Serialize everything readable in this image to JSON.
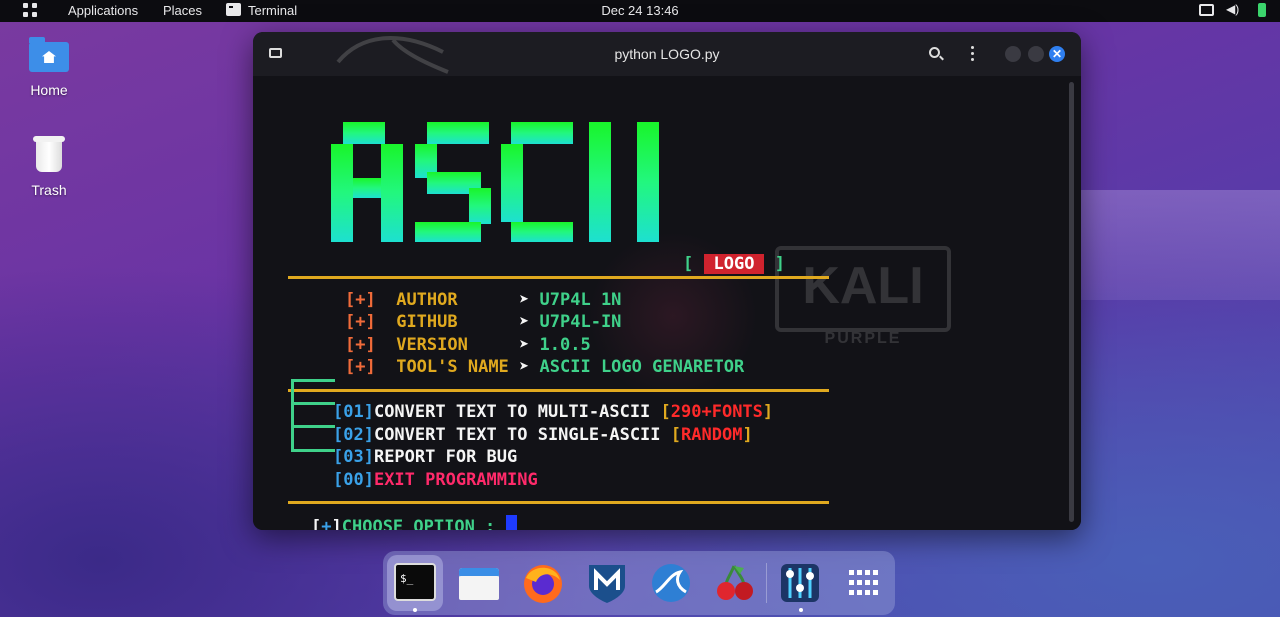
{
  "topbar": {
    "applications": "Applications",
    "places": "Places",
    "terminal": "Terminal",
    "clock": "Dec 24  13:46"
  },
  "desktop": {
    "home_label": "Home",
    "trash_label": "Trash"
  },
  "terminal_window": {
    "title": "python LOGO.py",
    "ascii_title_text": "ASCII",
    "logo_tag": {
      "open": "[",
      "label": "LOGO",
      "close": "]"
    },
    "info": [
      {
        "marker": "[+]",
        "key": "AUTHOR      ",
        "arrow": "➤",
        "value": "U7P4L 1N"
      },
      {
        "marker": "[+]",
        "key": "GITHUB      ",
        "arrow": "➤",
        "value": "U7P4L-IN"
      },
      {
        "marker": "[+]",
        "key": "VERSION     ",
        "arrow": "➤",
        "value": "1.0.5"
      },
      {
        "marker": "[+]",
        "key": "TOOL'S NAME ",
        "arrow": "➤",
        "value": "ASCII LOGO GENARETOR"
      }
    ],
    "menu": [
      {
        "num": "[01]",
        "text": "CONVERT TEXT TO MULTI-ASCII ",
        "tag_open": "[",
        "tag": "290+FONTS",
        "tag_close": "]"
      },
      {
        "num": "[02]",
        "text": "CONVERT TEXT TO SINGLE-ASCII ",
        "tag_open": "[",
        "tag": "RANDOM",
        "tag_close": "]"
      },
      {
        "num": "[03]",
        "text": "REPORT FOR BUG"
      },
      {
        "num": "[00]",
        "text": "EXIT PROGRAMMING"
      }
    ],
    "prompt": {
      "open": "[",
      "plus": "+",
      "close": "]",
      "text": "CHOOSE OPTION : "
    },
    "watermark": {
      "big": "KALI",
      "small": "PURPLE"
    }
  },
  "dock": {
    "items": [
      "terminal",
      "files",
      "firefox",
      "metasploit",
      "wireshark",
      "cherrytree",
      "settings-mixer",
      "show-apps"
    ]
  }
}
